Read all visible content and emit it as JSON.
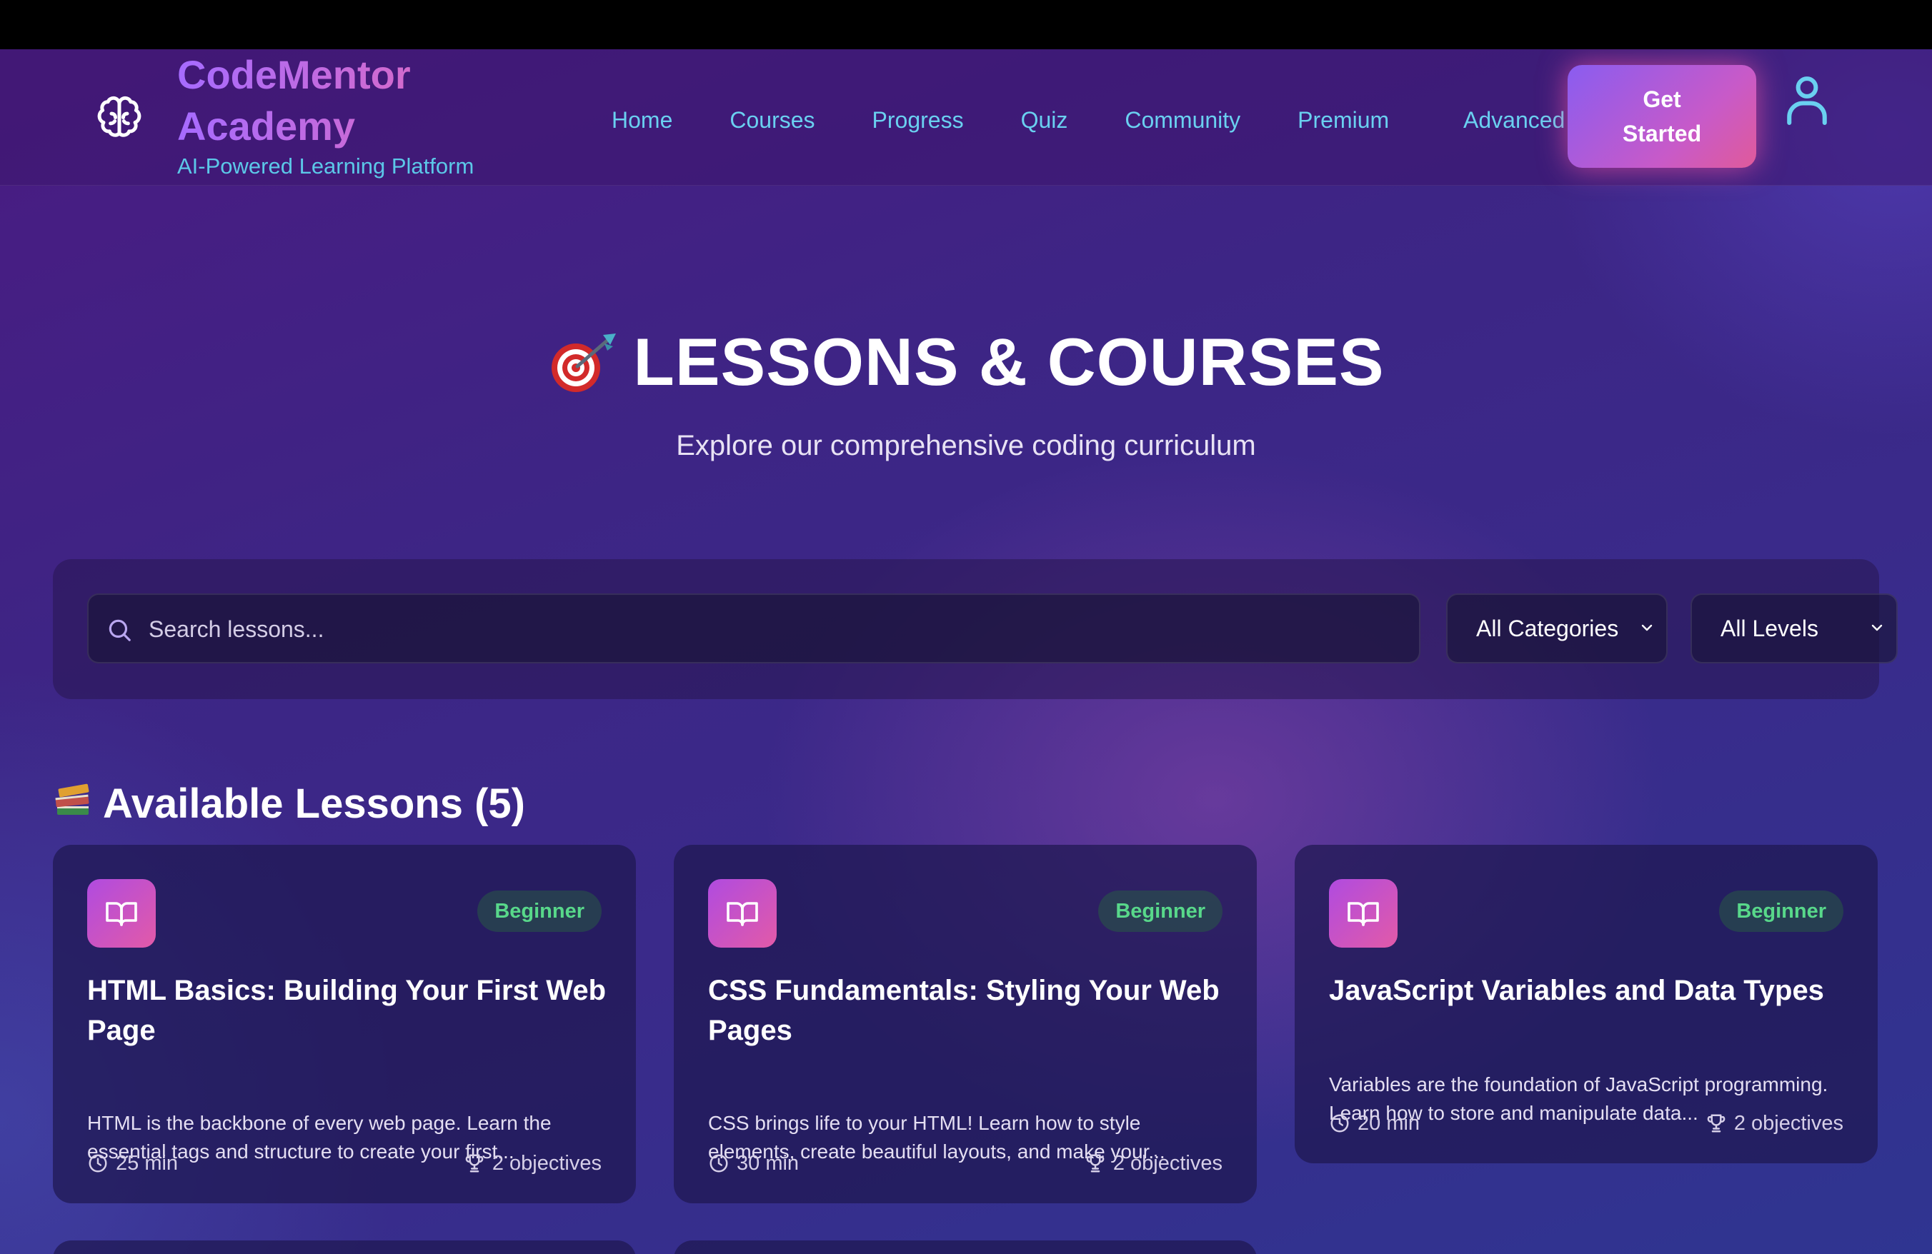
{
  "header": {
    "brand_title": "CodeMentor Academy",
    "brand_subtitle": "AI-Powered Learning Platform",
    "nav": [
      "Home",
      "Courses",
      "Progress",
      "Quiz",
      "Community",
      "Premium",
      "Advanced"
    ],
    "cta_label": "Get Started",
    "logo_icon": "brain-icon",
    "user_icon": "user-icon"
  },
  "hero": {
    "title": "LESSONS & COURSES",
    "subtitle": "Explore our comprehensive coding curriculum"
  },
  "filters": {
    "search_placeholder": "Search lessons...",
    "category_selected": "All Categories",
    "level_selected": "All Levels"
  },
  "section": {
    "title": "Available Lessons (5)"
  },
  "lessons": [
    {
      "level": "Beginner",
      "title": "HTML Basics: Building Your First Web Page",
      "description": "HTML is the backbone of every web page. Learn the essential tags and structure to create your first...",
      "duration": "25 min",
      "objectives": "2 objectives"
    },
    {
      "level": "Beginner",
      "title": "CSS Fundamentals: Styling Your Web Pages",
      "description": "CSS brings life to your HTML! Learn how to style elements, create beautiful layouts, and make your...",
      "duration": "30 min",
      "objectives": "2 objectives"
    },
    {
      "level": "Beginner",
      "title": "JavaScript Variables and Data Types",
      "description": "Variables are the foundation of JavaScript programming. Learn how to store and manipulate data...",
      "duration": "20 min",
      "objectives": "2 objectives"
    }
  ],
  "colors": {
    "accent_cyan": "#6ad0f0",
    "brand_gradient_start": "#a66bff",
    "brand_gradient_end": "#e56ab8",
    "badge_green": "#58d88a"
  }
}
